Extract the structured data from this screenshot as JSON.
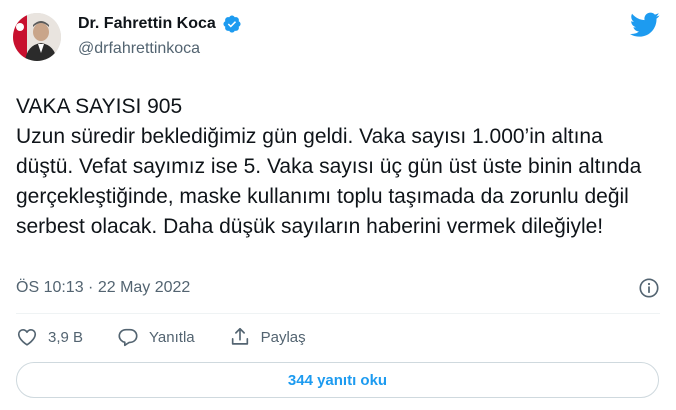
{
  "author": {
    "display_name": "Dr. Fahrettin Koca",
    "handle": "@drfahrettinkoca"
  },
  "tweet": {
    "text": "VAKA SAYISI 905\nUzun süredir beklediğimiz gün geldi. Vaka sayısı 1.000’in altına düştü. Vefat sayımız ise 5. Vaka sayısı üç gün üst üste binin altında gerçekleştiğinde, maske kullanımı toplu taşımada da zorunlu değil serbest olacak. Daha düşük sayıların haberini vermek dileğiyle!",
    "timestamp": "ÖS 10:13 · 22 May 2022"
  },
  "actions": {
    "like_count": "3,9 B",
    "reply_label": "Yanıtla",
    "share_label": "Paylaş"
  },
  "replies_button": {
    "label": "344 yanıtı oku"
  },
  "icons": {
    "verified": "verified-badge-icon",
    "brand": "twitter-bird-icon",
    "info": "info-icon",
    "like": "heart-icon",
    "reply": "speech-bubble-icon",
    "share": "share-icon"
  },
  "colors": {
    "accent": "#1d9bf0",
    "text": "#0f1419",
    "muted": "#536471",
    "border": "#cfd9de"
  }
}
